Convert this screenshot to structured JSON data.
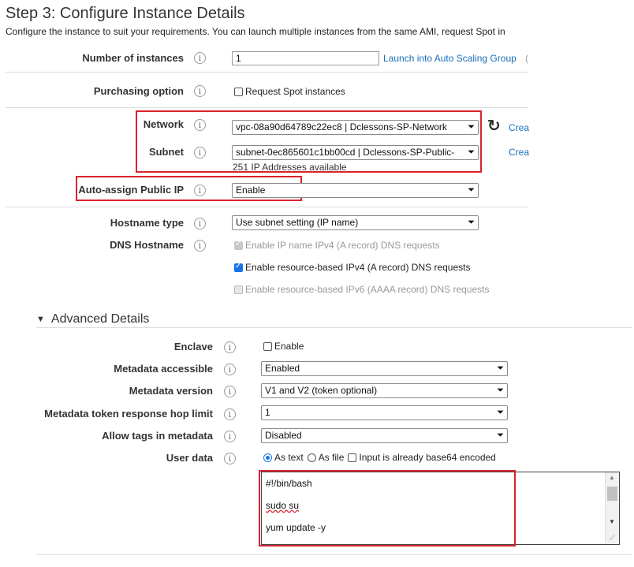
{
  "page": {
    "title": "Step 3: Configure Instance Details",
    "subtitle": "Configure the instance to suit your requirements. You can launch multiple instances from the same AMI, request Spot in"
  },
  "info_glyph": "i",
  "fields": {
    "num_instances": {
      "label": "Number of instances",
      "value": "1",
      "link": "Launch into Auto Scaling Group",
      "link_suffix": "("
    },
    "purchasing": {
      "label": "Purchasing option",
      "checkbox": "Request Spot instances"
    },
    "network": {
      "label": "Network",
      "value": "vpc-08a90d64789c22ec8 | Dclessons-SP-Network",
      "link": "Crea"
    },
    "subnet": {
      "label": "Subnet",
      "value": "subnet-0ec865601c1bb00cd | Dclessons-SP-Public-",
      "note": "251 IP Addresses available",
      "link": "Crea"
    },
    "auto_ip": {
      "label": "Auto-assign Public IP",
      "value": "Enable"
    },
    "hostname_type": {
      "label": "Hostname type",
      "value": "Use subnet setting (IP name)"
    },
    "dns_hostname": {
      "label": "DNS Hostname",
      "opt1": "Enable IP name IPv4 (A record) DNS requests",
      "opt2": "Enable resource-based IPv4 (A record) DNS requests",
      "opt3": "Enable resource-based IPv6 (AAAA record) DNS requests"
    }
  },
  "advanced": {
    "title": "Advanced Details",
    "enclave": {
      "label": "Enclave",
      "checkbox": "Enable"
    },
    "metadata_accessible": {
      "label": "Metadata accessible",
      "value": "Enabled"
    },
    "metadata_version": {
      "label": "Metadata version",
      "value": "V1 and V2 (token optional)"
    },
    "hop_limit": {
      "label": "Metadata token response hop limit",
      "value": "1"
    },
    "allow_tags": {
      "label": "Allow tags in metadata",
      "value": "Disabled"
    },
    "user_data": {
      "label": "User data",
      "as_text": "As text",
      "as_file": "As file",
      "base64": "Input is already base64 encoded",
      "lines": [
        "#!/bin/bash",
        "sudo su",
        "yum update -y"
      ]
    }
  },
  "glyphs": {
    "dropdown": "⏷",
    "refresh": "↻",
    "expand": "▼",
    "scroll_up": "▲",
    "scroll_down": "▼"
  },
  "colors": {
    "highlight": "#d9232d",
    "link": "#1a6fb8",
    "checked": "#1a73e8"
  }
}
